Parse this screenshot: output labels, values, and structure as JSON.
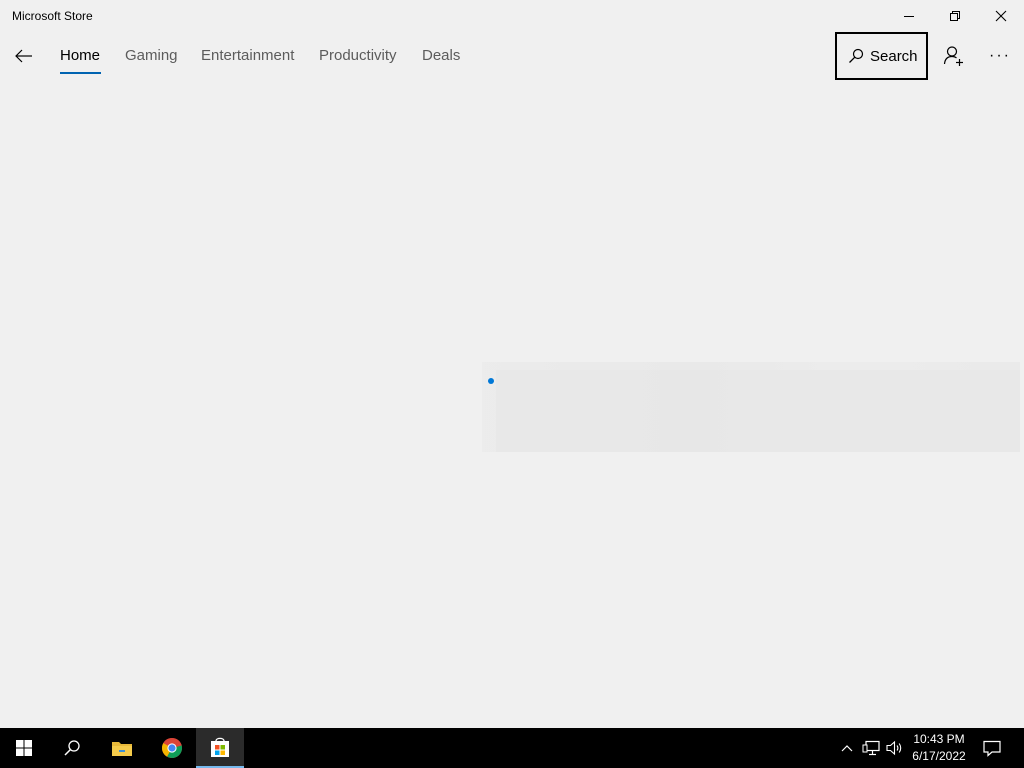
{
  "window": {
    "title": "Microsoft Store",
    "controls": [
      "minimize-icon",
      "restore-icon",
      "close-icon"
    ]
  },
  "nav": {
    "back_icon": "back-arrow-icon",
    "tabs": [
      {
        "label": "Home",
        "active": true
      },
      {
        "label": "Gaming",
        "active": false
      },
      {
        "label": "Entertainment",
        "active": false
      },
      {
        "label": "Productivity",
        "active": false
      },
      {
        "label": "Deals",
        "active": false
      }
    ],
    "search_label": "Search",
    "account_icon": "add-account-icon",
    "more_icon": "more-options-icon",
    "more_label": "···"
  },
  "content": {
    "state": "loading"
  },
  "taskbar": {
    "items": [
      {
        "name": "start",
        "icon": "windows-logo-icon"
      },
      {
        "name": "search",
        "icon": "search-icon"
      },
      {
        "name": "file-explorer",
        "icon": "folder-icon"
      },
      {
        "name": "chrome",
        "icon": "chrome-icon"
      },
      {
        "name": "microsoft-store",
        "icon": "store-icon",
        "active": true
      }
    ],
    "tray": [
      "chevron-up-icon",
      "network-icon",
      "volume-icon"
    ],
    "time": "10:43 PM",
    "date": "6/17/2022",
    "notification_icon": "action-center-icon"
  },
  "colors": {
    "accent": "#0063b1",
    "loading_dot": "#0078d7",
    "taskbar_active_indicator": "#76b9ed",
    "background": "#f0f0f0"
  }
}
